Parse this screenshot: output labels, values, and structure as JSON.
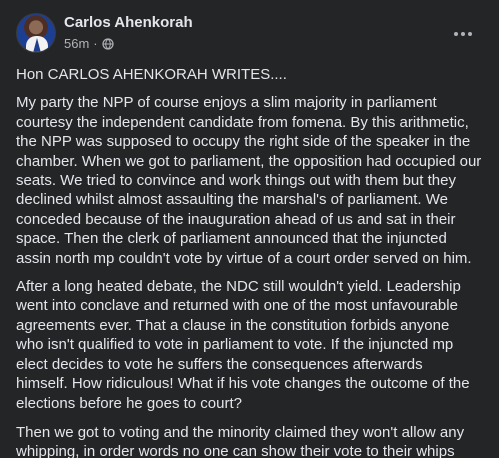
{
  "post": {
    "author_name": "Carlos Ahenkorah",
    "timestamp": "56m",
    "separator": "·",
    "privacy_icon": "globe-icon",
    "more_icon": "more-options-icon",
    "heading": "Hon CARLOS AHENKORAH WRITES....",
    "paragraph_1": "My party the NPP of course enjoys a slim majority in parliament courtesy the independent candidate from fomena. By this arithmetic, the NPP was supposed to occupy the right side of the speaker in the chamber. When we got to parliament, the opposition had occupied our seats. We tried to convince and work things out with them but they declined whilst almost assaulting the marshal's of parliament. We conceded because of the inauguration ahead of us and sat in their space. Then the clerk of parliament announced that the injuncted assin north mp couldn't vote by virtue of a court order served on him.",
    "paragraph_2": "After a long heated debate, the NDC still wouldn't yield. Leadership went into conclave and returned with one of the most unfavourable agreements ever. That a clause in the constitution forbids anyone who isn't qualified to vote in parliament to vote. If the injuncted mp elect decides to vote he suffers the consequences afterwards himself. How ridiculous! What if his vote changes the outcome of the elections before he goes to court?",
    "paragraph_3": "Then we got to voting and the minority claimed they won't allow any whipping, in order words no one can show their vote to their whips"
  },
  "colors": {
    "background": "#242526",
    "primary_text": "#e4e6eb",
    "secondary_text": "#b0b3b8"
  }
}
